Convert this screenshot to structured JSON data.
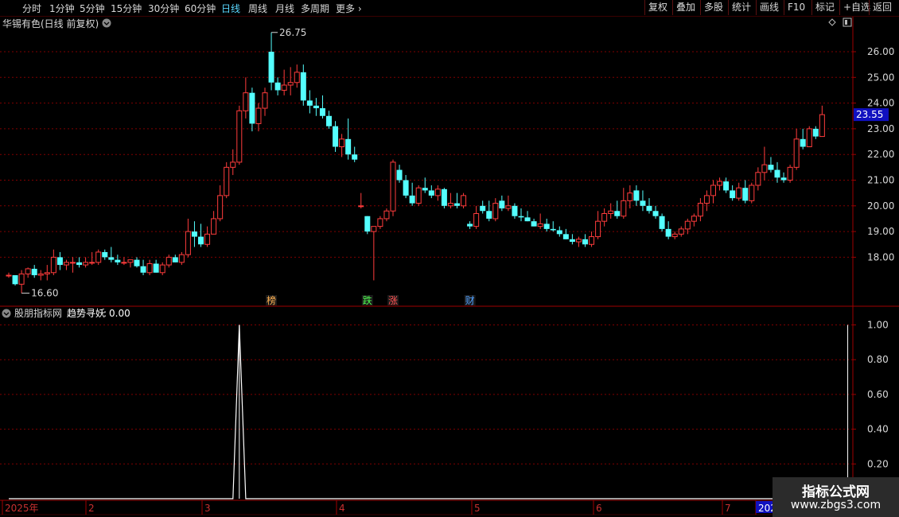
{
  "toolbar": {
    "periods": [
      "分时",
      "1分钟",
      "5分钟",
      "15分钟",
      "30分钟",
      "60分钟",
      "日线",
      "周线",
      "月线",
      "多周期",
      "更多"
    ],
    "active_period": "日线",
    "right_buttons": [
      "复权",
      "叠加",
      "多股",
      "统计",
      "画线",
      "F10",
      "标记",
      "+自选",
      "返回"
    ]
  },
  "main_panel": {
    "title": "华锡有色(日线 前复权)",
    "high_label": "26.75",
    "low_label": "16.60",
    "price_tag": "23.55",
    "axis_labels": [
      "26.00",
      "25.00",
      "24.00",
      "23.00",
      "22.00",
      "21.00",
      "20.00",
      "19.00",
      "18.00"
    ],
    "event_markers": [
      {
        "text": "榜",
        "color": "#ffb050",
        "index": 41
      },
      {
        "text": "跌",
        "color": "#50ff50",
        "index": 56
      },
      {
        "text": "涨",
        "color": "#ff5050",
        "index": 60
      },
      {
        "text": "财",
        "color": "#50a0ff",
        "index": 72
      }
    ]
  },
  "indicator_panel": {
    "source": "股朋指标网",
    "name": "趋势寻妖",
    "value": "0.00",
    "axis_labels": [
      "1.00",
      "0.80",
      "0.60",
      "0.40",
      "0.20"
    ]
  },
  "date_axis": {
    "labels": [
      "2025年",
      "2",
      "3",
      "4",
      "5",
      "6",
      "7",
      "202"
    ]
  },
  "watermark": {
    "title": "指标公式网",
    "url": "www.zbgs3.com"
  },
  "colors": {
    "up": "#ff3c3c",
    "down": "#54ffff",
    "grid": "#800000",
    "axis": "#a00000",
    "signal": "#ffffff"
  },
  "chart_data": [
    {
      "type": "candlestick",
      "title": "华锡有色(日线 前复权)",
      "ylim": [
        16.6,
        26.75
      ],
      "y_ticks": [
        18,
        19,
        20,
        21,
        22,
        23,
        24,
        25,
        26
      ],
      "last_price": 23.55,
      "high": 26.75,
      "low": 16.6,
      "ohlc": [
        [
          17.3,
          17.4,
          17.2,
          17.3
        ],
        [
          17.3,
          17.3,
          16.9,
          16.95
        ],
        [
          16.95,
          17.5,
          16.6,
          17.35
        ],
        [
          17.35,
          17.6,
          17.2,
          17.55
        ],
        [
          17.55,
          17.7,
          17.2,
          17.3
        ],
        [
          17.3,
          17.5,
          17.1,
          17.35
        ],
        [
          17.35,
          17.7,
          17.1,
          17.4
        ],
        [
          17.4,
          18.3,
          17.3,
          18.0
        ],
        [
          18.0,
          18.2,
          17.5,
          17.7
        ],
        [
          17.7,
          17.9,
          17.5,
          17.8
        ],
        [
          17.8,
          18.0,
          17.4,
          17.8
        ],
        [
          17.8,
          18.0,
          17.6,
          17.7
        ],
        [
          17.7,
          18.0,
          17.6,
          17.8
        ],
        [
          17.8,
          18.2,
          17.7,
          17.8
        ],
        [
          17.8,
          18.3,
          17.7,
          18.2
        ],
        [
          18.2,
          18.3,
          17.9,
          18.0
        ],
        [
          18.0,
          18.4,
          17.8,
          17.9
        ],
        [
          17.9,
          18.1,
          17.7,
          17.8
        ],
        [
          17.8,
          18.0,
          17.7,
          17.8
        ],
        [
          17.8,
          17.9,
          17.6,
          17.9
        ],
        [
          17.9,
          18.0,
          17.6,
          17.65
        ],
        [
          17.65,
          17.9,
          17.3,
          17.4
        ],
        [
          17.4,
          17.9,
          17.3,
          17.75
        ],
        [
          17.75,
          17.9,
          17.4,
          17.4
        ],
        [
          17.4,
          17.8,
          17.3,
          17.7
        ],
        [
          17.7,
          18.1,
          17.6,
          18.0
        ],
        [
          18.0,
          18.1,
          17.8,
          17.8
        ],
        [
          17.8,
          18.2,
          17.7,
          18.1
        ],
        [
          18.1,
          19.5,
          18.0,
          19.0
        ],
        [
          19.0,
          19.4,
          18.4,
          18.8
        ],
        [
          18.8,
          19.3,
          18.4,
          18.5
        ],
        [
          18.5,
          19.2,
          18.4,
          18.9
        ],
        [
          18.9,
          19.8,
          18.9,
          19.5
        ],
        [
          19.5,
          20.8,
          19.4,
          20.4
        ],
        [
          20.4,
          21.7,
          20.3,
          21.5
        ],
        [
          21.5,
          22.2,
          21.2,
          21.7
        ],
        [
          21.7,
          23.9,
          21.6,
          23.7
        ],
        [
          23.7,
          25.0,
          23.4,
          24.4
        ],
        [
          24.4,
          24.6,
          22.9,
          23.2
        ],
        [
          23.2,
          24.0,
          22.9,
          23.8
        ],
        [
          23.8,
          24.6,
          23.5,
          24.4
        ],
        [
          26.0,
          26.75,
          24.5,
          24.8
        ],
        [
          24.8,
          25.0,
          24.3,
          24.5
        ],
        [
          24.5,
          25.3,
          24.3,
          24.7
        ],
        [
          24.7,
          25.4,
          24.3,
          24.8
        ],
        [
          24.8,
          25.5,
          24.6,
          25.2
        ],
        [
          25.2,
          25.5,
          23.9,
          24.1
        ],
        [
          24.1,
          24.5,
          23.6,
          23.9
        ],
        [
          23.9,
          24.2,
          23.5,
          23.8
        ],
        [
          23.8,
          24.3,
          23.4,
          23.5
        ],
        [
          23.5,
          23.7,
          23.0,
          23.1
        ],
        [
          23.1,
          23.3,
          22.1,
          22.3
        ],
        [
          22.3,
          22.8,
          21.9,
          22.6
        ],
        [
          22.6,
          23.4,
          21.8,
          22.0
        ],
        [
          22.0,
          22.3,
          21.7,
          21.8
        ],
        [
          20.0,
          20.5,
          19.9,
          20.0
        ],
        [
          19.6,
          19.6,
          18.9,
          19.0
        ],
        [
          19.0,
          19.2,
          17.1,
          19.2
        ],
        [
          19.2,
          19.6,
          19.1,
          19.5
        ],
        [
          19.5,
          19.9,
          19.4,
          19.8
        ],
        [
          19.8,
          21.8,
          19.6,
          21.7
        ],
        [
          21.4,
          21.6,
          20.9,
          21.0
        ],
        [
          21.0,
          21.2,
          20.3,
          20.4
        ],
        [
          20.4,
          20.9,
          20.0,
          20.1
        ],
        [
          20.1,
          20.8,
          20.0,
          20.7
        ],
        [
          20.7,
          21.1,
          20.5,
          20.6
        ],
        [
          20.6,
          20.8,
          20.3,
          20.4
        ],
        [
          20.4,
          20.8,
          20.2,
          20.65
        ],
        [
          20.65,
          20.7,
          19.9,
          20.0
        ],
        [
          20.0,
          20.5,
          19.9,
          20.1
        ],
        [
          20.1,
          20.5,
          19.9,
          20.0
        ],
        [
          20.0,
          20.5,
          19.9,
          20.4
        ],
        [
          19.3,
          19.4,
          19.1,
          19.2
        ],
        [
          19.2,
          20.0,
          19.1,
          19.7
        ],
        [
          20.0,
          20.2,
          19.7,
          19.8
        ],
        [
          19.8,
          20.2,
          19.4,
          19.5
        ],
        [
          19.5,
          20.3,
          19.4,
          20.1
        ],
        [
          20.2,
          20.4,
          19.8,
          19.9
        ],
        [
          19.9,
          20.4,
          19.8,
          20.0
        ],
        [
          20.0,
          20.1,
          19.5,
          19.6
        ],
        [
          19.6,
          19.9,
          19.4,
          19.55
        ],
        [
          19.55,
          19.8,
          19.4,
          19.4
        ],
        [
          19.4,
          19.5,
          19.2,
          19.2
        ],
        [
          19.2,
          19.7,
          19.1,
          19.3
        ],
        [
          19.3,
          19.5,
          19.0,
          19.1
        ],
        [
          19.1,
          19.4,
          19.0,
          19.05
        ],
        [
          19.05,
          19.2,
          18.8,
          18.9
        ],
        [
          18.9,
          19.1,
          18.7,
          18.7
        ],
        [
          18.7,
          18.9,
          18.5,
          18.6
        ],
        [
          18.6,
          18.8,
          18.4,
          18.7
        ],
        [
          18.7,
          18.9,
          18.4,
          18.5
        ],
        [
          18.5,
          19.0,
          18.4,
          18.8
        ],
        [
          18.8,
          19.8,
          18.7,
          19.4
        ],
        [
          19.4,
          19.9,
          19.2,
          19.7
        ],
        [
          19.7,
          20.1,
          19.5,
          19.8
        ],
        [
          19.8,
          20.2,
          19.5,
          19.6
        ],
        [
          19.6,
          20.7,
          19.5,
          20.2
        ],
        [
          20.2,
          20.8,
          19.9,
          20.5
        ],
        [
          20.6,
          20.8,
          20.0,
          20.2
        ],
        [
          20.2,
          20.6,
          19.8,
          20.0
        ],
        [
          20.0,
          20.3,
          19.7,
          19.8
        ],
        [
          19.8,
          20.0,
          19.5,
          19.6
        ],
        [
          19.6,
          19.7,
          19.0,
          19.1
        ],
        [
          19.1,
          19.4,
          18.7,
          18.8
        ],
        [
          18.8,
          19.0,
          18.7,
          18.9
        ],
        [
          18.9,
          19.2,
          18.8,
          19.1
        ],
        [
          19.1,
          19.5,
          18.9,
          19.4
        ],
        [
          19.4,
          19.7,
          19.2,
          19.6
        ],
        [
          19.6,
          20.3,
          19.4,
          20.1
        ],
        [
          20.1,
          20.6,
          19.8,
          20.4
        ],
        [
          20.4,
          21.0,
          20.1,
          20.8
        ],
        [
          20.8,
          21.1,
          20.6,
          20.95
        ],
        [
          20.95,
          21.1,
          20.5,
          20.6
        ],
        [
          20.6,
          20.8,
          20.2,
          20.3
        ],
        [
          20.3,
          20.9,
          20.2,
          20.7
        ],
        [
          20.7,
          21.0,
          20.1,
          20.2
        ],
        [
          20.2,
          20.9,
          20.1,
          20.8
        ],
        [
          20.8,
          21.5,
          20.6,
          21.3
        ],
        [
          21.3,
          22.3,
          21.0,
          21.6
        ],
        [
          21.6,
          21.9,
          21.3,
          21.4
        ],
        [
          21.4,
          21.7,
          20.9,
          21.1
        ],
        [
          21.1,
          21.3,
          20.9,
          21.0
        ],
        [
          21.0,
          21.6,
          20.9,
          21.5
        ],
        [
          21.5,
          23.0,
          21.4,
          22.6
        ],
        [
          22.6,
          23.0,
          22.2,
          22.3
        ],
        [
          22.3,
          23.1,
          22.3,
          23.0
        ],
        [
          23.0,
          23.1,
          22.6,
          22.7
        ],
        [
          22.7,
          23.9,
          22.7,
          23.55
        ]
      ]
    },
    {
      "type": "line",
      "series": [
        {
          "name": "趋势寻妖"
        }
      ],
      "ylim": [
        0,
        1
      ],
      "y_ticks": [
        0.2,
        0.4,
        0.6,
        0.8,
        1.0
      ],
      "spikes_at_index": [
        36,
        131
      ],
      "x_categories": [
        "2025年",
        "2",
        "3",
        "4",
        "5",
        "6",
        "7",
        "202"
      ]
    }
  ]
}
